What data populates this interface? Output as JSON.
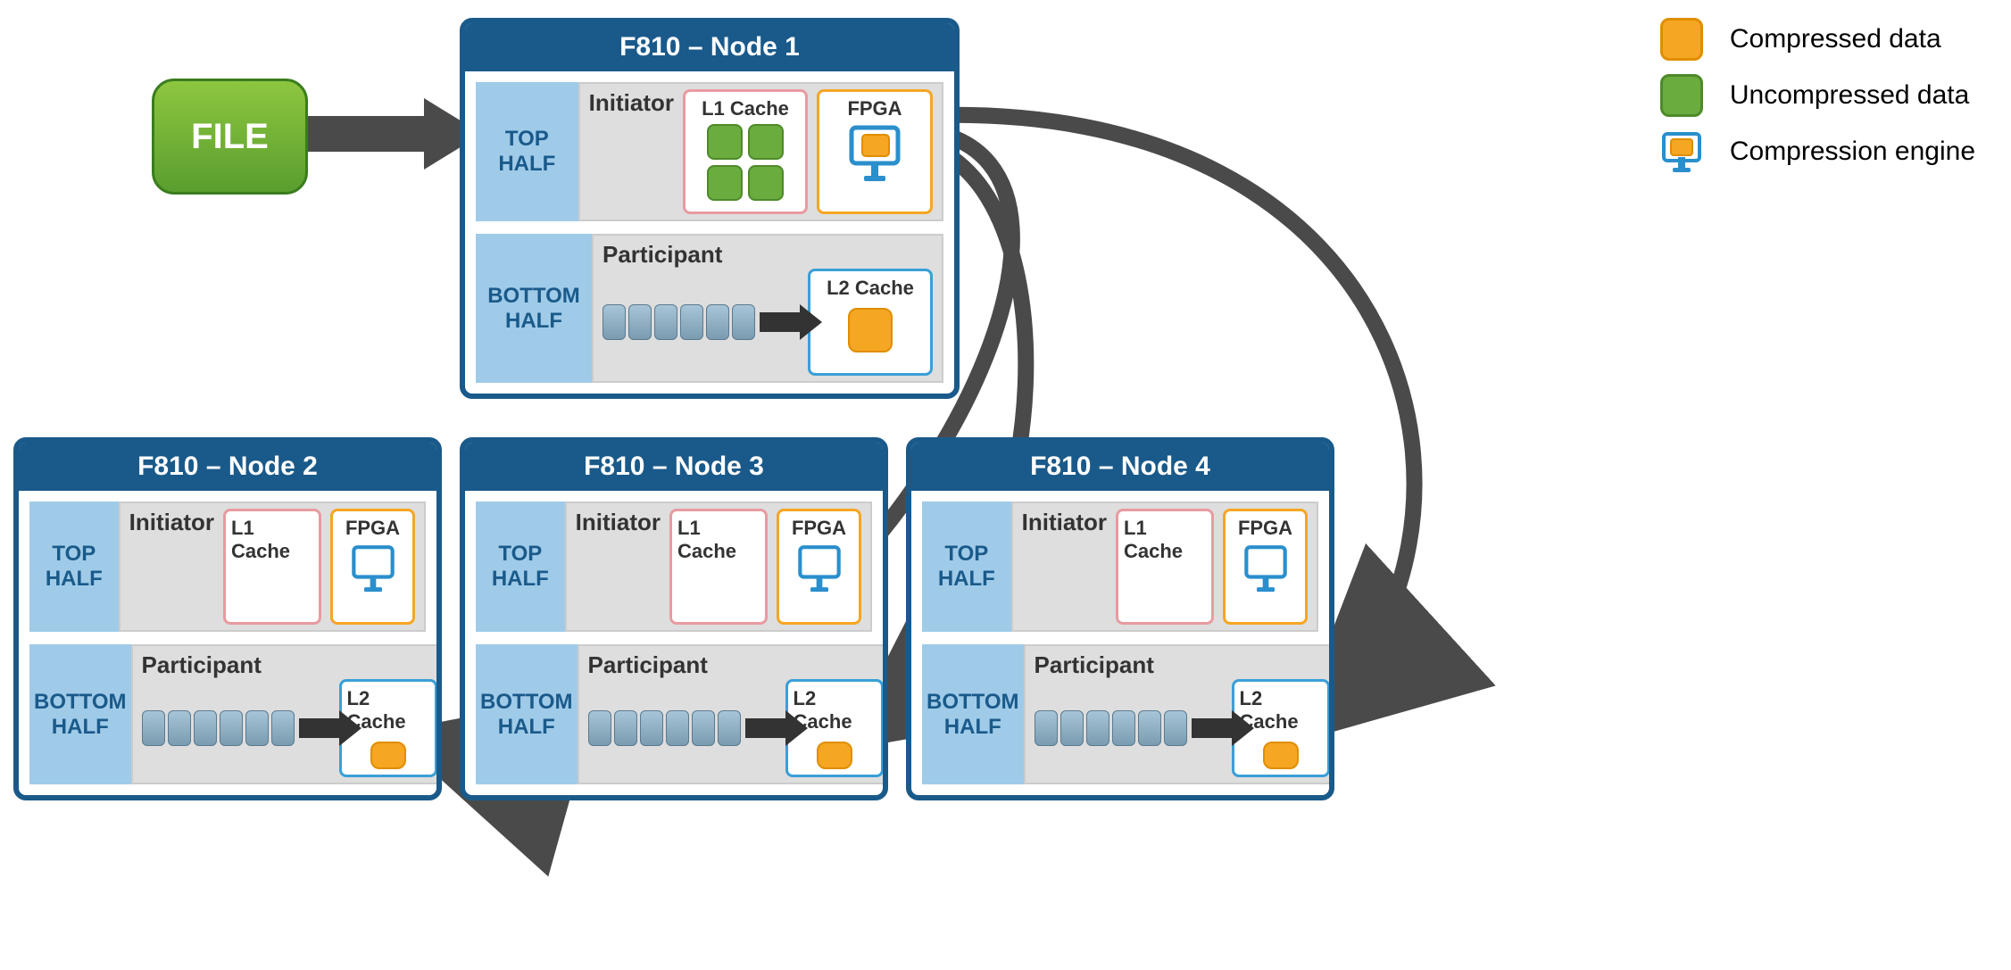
{
  "legend": {
    "compressed": "Compressed data",
    "uncompressed": "Uncompressed data",
    "engine": "Compression engine"
  },
  "file": {
    "label": "FILE"
  },
  "common": {
    "top_half": "TOP HALF",
    "bottom_half": "BOTTOM HALF",
    "initiator": "Initiator",
    "participant": "Participant",
    "l1_cache": "L1 Cache",
    "l2_cache": "L2 Cache",
    "fpga": "FPGA"
  },
  "nodes": {
    "n1": {
      "title": "F810 – Node 1"
    },
    "n2": {
      "title": "F810 – Node 2"
    },
    "n3": {
      "title": "F810 – Node 3"
    },
    "n4": {
      "title": "F810 – Node 4"
    }
  }
}
